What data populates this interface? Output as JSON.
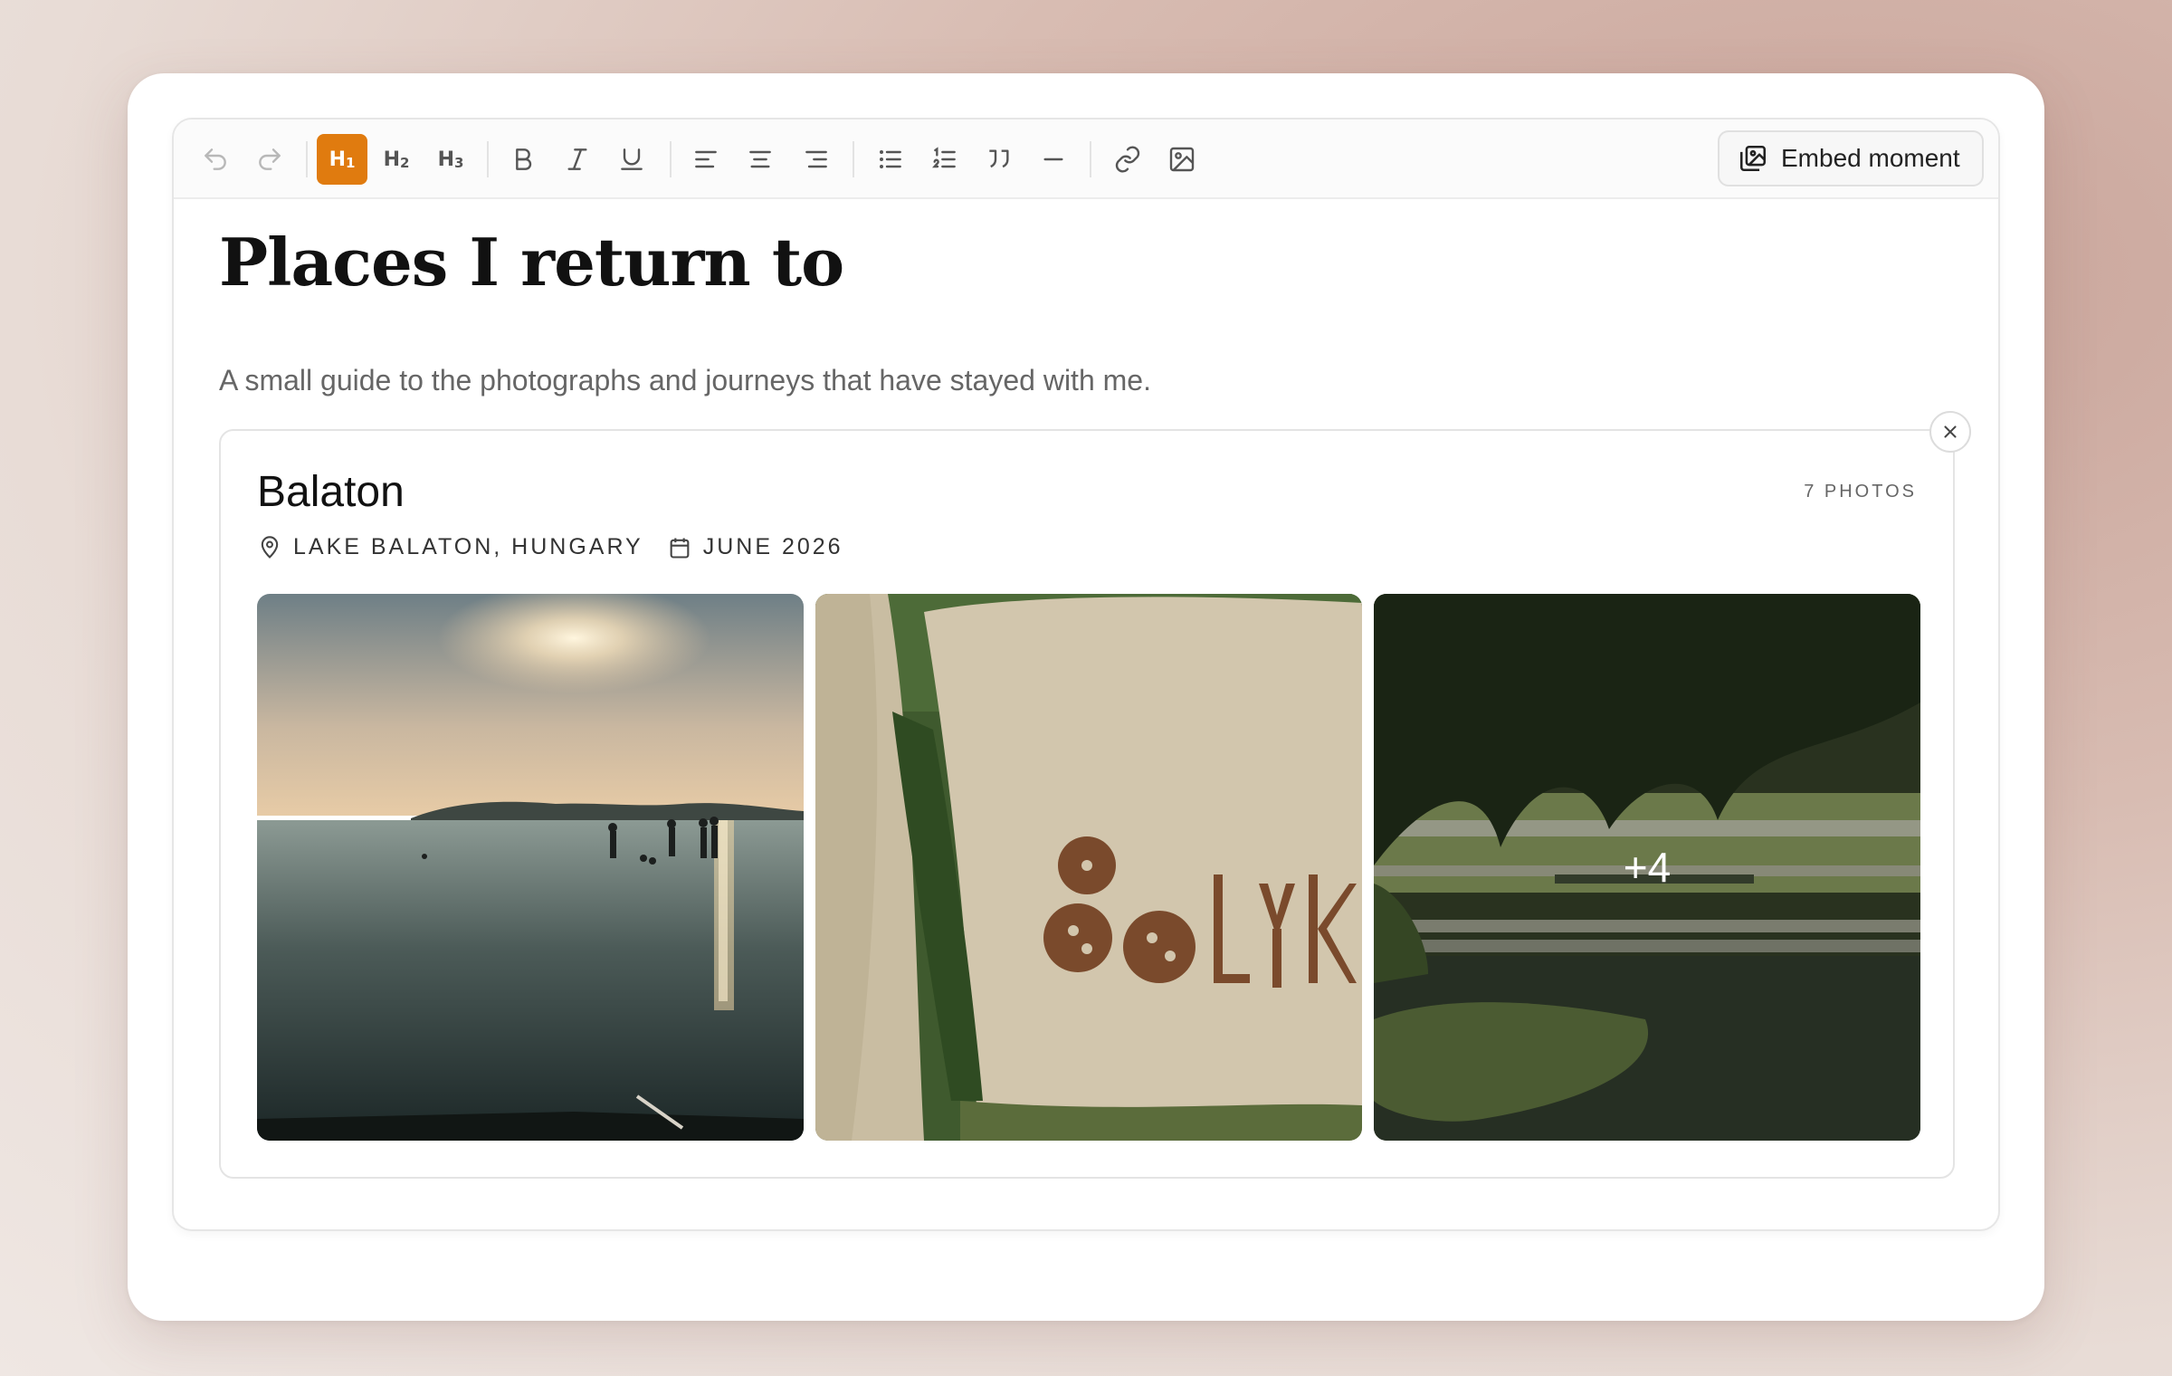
{
  "toolbar": {
    "heading_buttons": [
      "H1",
      "H2",
      "H3"
    ],
    "embed_label": "Embed moment",
    "active": "H1",
    "accent_color": "#e07b0f"
  },
  "document": {
    "title": "Places I return to",
    "subtitle": "A small guide to the photographs and journeys that have stayed with me."
  },
  "moment": {
    "title": "Balaton",
    "photo_count": "7 PHOTOS",
    "location": "LAKE BALATON, HUNGARY",
    "date": "JUNE 2026",
    "more_overlay": "+4",
    "photos": [
      "lake-sunset-swimmers",
      "bolyki-rock-sign",
      "park-pond-willow"
    ]
  }
}
